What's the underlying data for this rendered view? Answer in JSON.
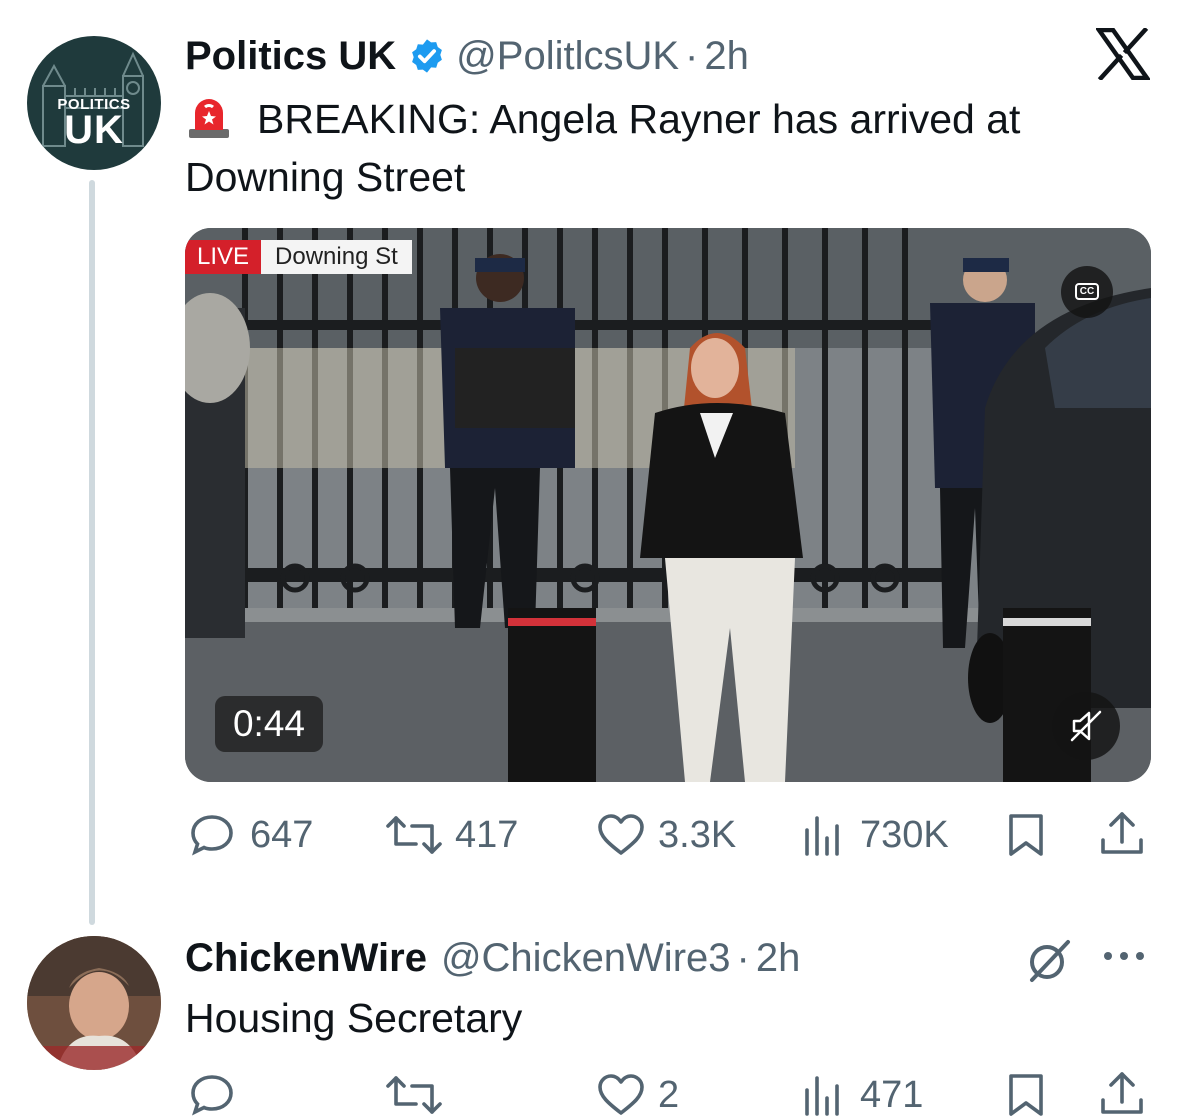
{
  "tweet": {
    "avatar_text_top": "POLITICS",
    "avatar_text_bottom": "UK",
    "name": "Politics UK",
    "handle": "@PolitlcsUK",
    "separator": "·",
    "time": "2h",
    "text_line1": "BREAKING: Angela Rayner has arrived at",
    "text_line2": "Downing Street",
    "icons": {
      "siren": "police-light-emoji-icon",
      "verified": "verified-badge-icon",
      "x_logo": "x-logo-icon"
    },
    "media": {
      "live_label": "LIVE",
      "location_label": "Downing St",
      "cc_label": "CC",
      "duration": "0:44"
    },
    "stats": {
      "replies": "647",
      "reposts": "417",
      "likes": "3.3K",
      "views": "730K"
    },
    "colors": {
      "verified": "#1d9bf0",
      "live": "#d4202a",
      "avatar_bg": "#1f3a3c",
      "muted_text": "#536471"
    }
  },
  "reply": {
    "name": "ChickenWire",
    "handle": "@ChickenWire3",
    "separator": "·",
    "time": "2h",
    "text": "Housing Secretary",
    "stats": {
      "replies": "",
      "reposts": "",
      "likes": "2",
      "views": "471"
    }
  }
}
